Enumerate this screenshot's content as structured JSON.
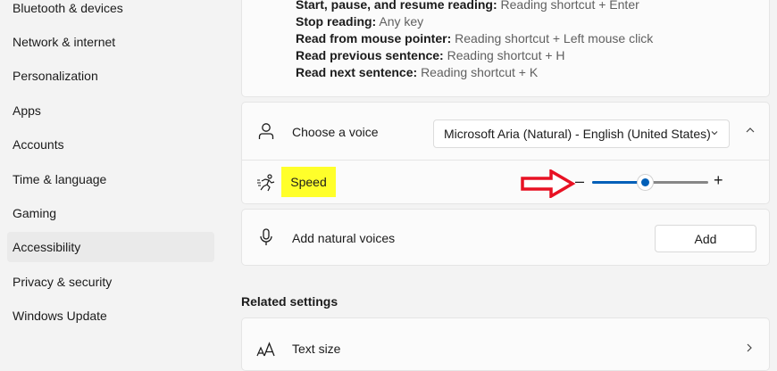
{
  "sidebar": {
    "items": [
      {
        "label": "Bluetooth & devices",
        "selected": false
      },
      {
        "label": "Network & internet",
        "selected": false
      },
      {
        "label": "Personalization",
        "selected": false
      },
      {
        "label": "Apps",
        "selected": false
      },
      {
        "label": "Accounts",
        "selected": false
      },
      {
        "label": "Time & language",
        "selected": false
      },
      {
        "label": "Gaming",
        "selected": false
      },
      {
        "label": "Accessibility",
        "selected": true
      },
      {
        "label": "Privacy & security",
        "selected": false
      },
      {
        "label": "Windows Update",
        "selected": false
      }
    ]
  },
  "shortcuts": {
    "lines": [
      {
        "label": "Start, pause, and resume reading:",
        "value": "Reading shortcut + Enter"
      },
      {
        "label": "Stop reading:",
        "value": "Any key"
      },
      {
        "label": "Read from mouse pointer:",
        "value": "Reading shortcut + Left mouse click"
      },
      {
        "label": "Read previous sentence:",
        "value": "Reading shortcut + H"
      },
      {
        "label": "Read next sentence:",
        "value": "Reading shortcut + K"
      }
    ]
  },
  "voice": {
    "label": "Choose a voice",
    "selected_value": "Microsoft Aria (Natural) - English (United States)",
    "icon": "person-icon"
  },
  "speed": {
    "label": "Speed",
    "minus": "–",
    "plus": "+",
    "value_fraction": 0.45,
    "highlight_color": "#ffff2a",
    "arrow_color": "#e81123"
  },
  "natural_voices": {
    "label": "Add natural voices",
    "button_label": "Add",
    "icon": "microphone-icon"
  },
  "related": {
    "title": "Related settings",
    "items": [
      {
        "label": "Text size",
        "icon": "text-size-icon"
      }
    ]
  },
  "colors": {
    "accent": "#005fb8"
  }
}
